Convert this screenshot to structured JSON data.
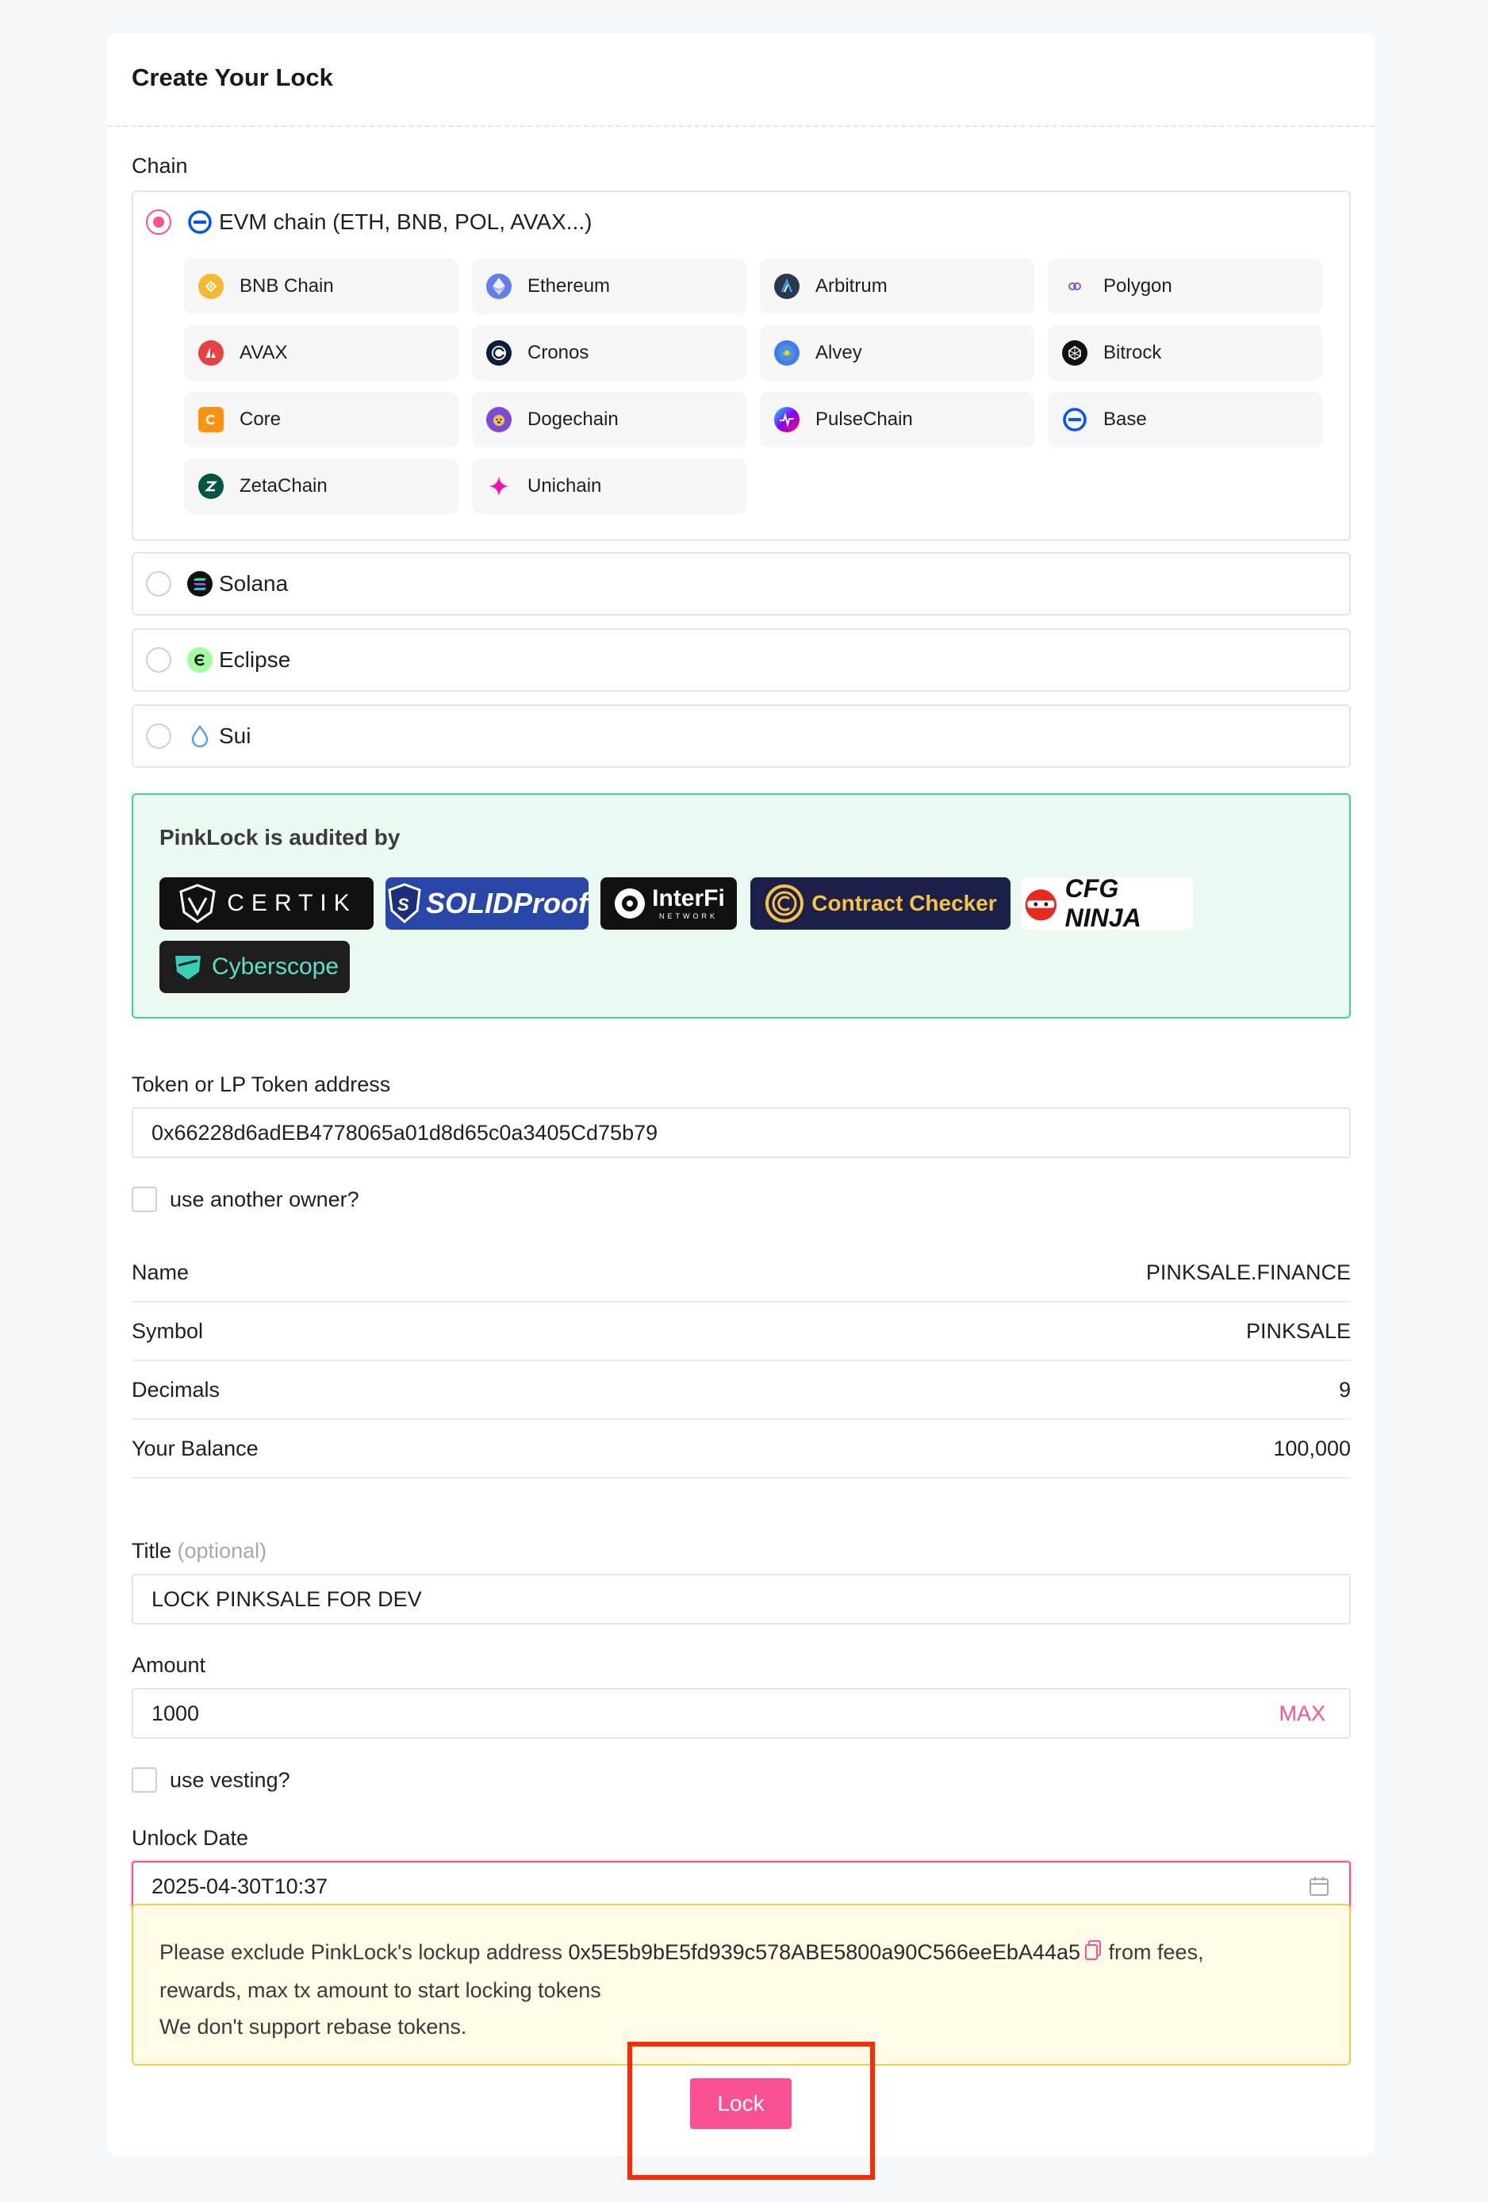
{
  "page": {
    "title": "Create Your Lock"
  },
  "chain": {
    "label": "Chain",
    "options": [
      {
        "label": "EVM chain (ETH, BNB, POL, AVAX...)",
        "icon": "evm-icon",
        "checked": true
      },
      {
        "label": "Solana",
        "icon": "solana-icon",
        "checked": false
      },
      {
        "label": "Eclipse",
        "icon": "eclipse-icon",
        "checked": false
      },
      {
        "label": "Sui",
        "icon": "sui-icon",
        "checked": false
      }
    ],
    "evm_networks": [
      {
        "label": "BNB Chain",
        "icon": "bnb-icon",
        "color": "#f3ba2f"
      },
      {
        "label": "Ethereum",
        "icon": "ethereum-icon",
        "color": "#627eea"
      },
      {
        "label": "Arbitrum",
        "icon": "arbitrum-icon",
        "color": "#2d374b"
      },
      {
        "label": "Polygon",
        "icon": "polygon-icon",
        "color": "#8247e5"
      },
      {
        "label": "AVAX",
        "icon": "avax-icon",
        "color": "#e84142"
      },
      {
        "label": "Cronos",
        "icon": "cronos-icon",
        "color": "#0b1d3a"
      },
      {
        "label": "Alvey",
        "icon": "alvey-icon",
        "color": "#2e7d32"
      },
      {
        "label": "Bitrock",
        "icon": "bitrock-icon",
        "color": "#111111"
      },
      {
        "label": "Core",
        "icon": "core-icon",
        "color": "#ff9211"
      },
      {
        "label": "Dogechain",
        "icon": "dogechain-icon",
        "color": "#7b4ad6"
      },
      {
        "label": "PulseChain",
        "icon": "pulsechain-icon",
        "color": "#e0148b"
      },
      {
        "label": "Base",
        "icon": "base-icon",
        "color": "#0052ff"
      },
      {
        "label": "ZetaChain",
        "icon": "zetachain-icon",
        "color": "#005741"
      },
      {
        "label": "Unichain",
        "icon": "unichain-icon",
        "color": "#f50db4"
      }
    ]
  },
  "audit": {
    "title": "PinkLock is audited by",
    "logos": [
      "CERTIK",
      "SOLIDProof",
      "InterFi",
      "Contract Checker",
      "CFG NINJA",
      "Cyberscope"
    ],
    "logo_sub": {
      "interfi": "NETWORK"
    }
  },
  "token": {
    "label": "Token or LP Token address",
    "value": "0x66228d6adEB4778065a01d8d65c0a3405Cd75b79"
  },
  "another_owner": {
    "label": "use another owner?",
    "checked": false
  },
  "token_info": [
    {
      "key": "Name",
      "value": "PINKSALE.FINANCE"
    },
    {
      "key": "Symbol",
      "value": "PINKSALE"
    },
    {
      "key": "Decimals",
      "value": "9"
    },
    {
      "key": "Your Balance",
      "value": "100,000"
    }
  ],
  "title_field": {
    "label": "Title",
    "optional": "(optional)",
    "value": "LOCK PINKSALE FOR DEV"
  },
  "amount": {
    "label": "Amount",
    "value": "1000",
    "max_label": "MAX"
  },
  "vesting": {
    "label": "use vesting?",
    "checked": false
  },
  "unlock_date": {
    "label": "Unlock Date",
    "value": "2025-04-30T10:37"
  },
  "warning": {
    "prefix": "Please exclude PinkLock's lockup address",
    "address": "0x5E5b9bE5fd939c578ABE5800a90C566eeEbA44a5",
    "suffix": "from fees,",
    "line2": "rewards, max tx amount to start locking tokens",
    "line3": "We don't support rebase tokens."
  },
  "actions": {
    "lock_label": "Lock"
  },
  "colors": {
    "accent": "#f95192",
    "audit_border": "#41d391",
    "warning_border": "#f2cf47",
    "highlight": "#ff2a00"
  }
}
